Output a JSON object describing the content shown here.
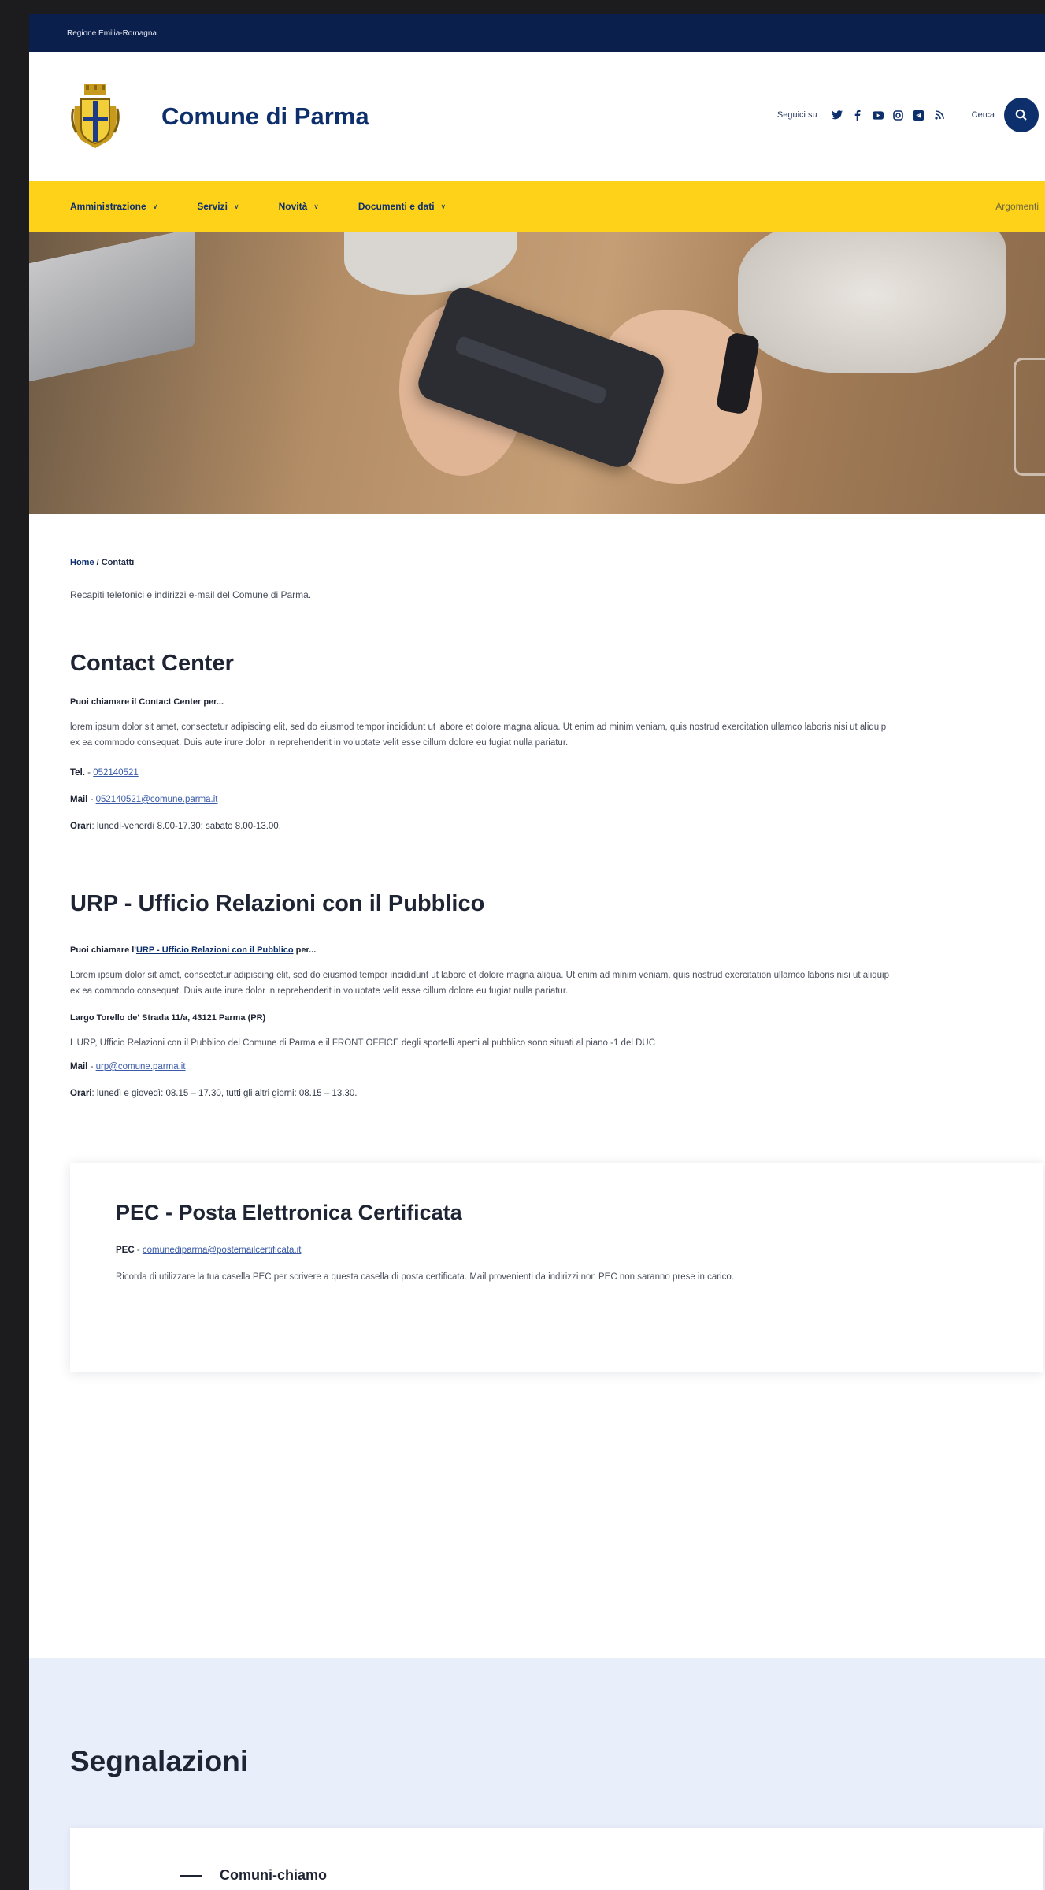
{
  "region_bar": {
    "label": "Regione Emilia-Romagna"
  },
  "header": {
    "title": "Comune di Parma",
    "follow_label": "Seguici su",
    "search_label": "Cerca",
    "social_icons": [
      "twitter-icon",
      "facebook-icon",
      "youtube-icon",
      "instagram-icon",
      "telegram-icon",
      "rss-icon"
    ]
  },
  "nav": {
    "items": [
      {
        "label": "Amministrazione"
      },
      {
        "label": "Servizi"
      },
      {
        "label": "Novità"
      },
      {
        "label": "Documenti e dati"
      }
    ],
    "topics": "Argomenti"
  },
  "breadcrumb": {
    "home": "Home",
    "separator": " / ",
    "current": "Contatti"
  },
  "intro": "Recapiti telefonici e indirizzi e-mail del Comune di Parma.",
  "contact_center": {
    "title": "Contact Center",
    "subhead": "Puoi chiamare il Contact Center per...",
    "lorem": "lorem ipsum dolor sit amet, consectetur adipiscing elit, sed do eiusmod tempor incididunt ut labore et dolore magna aliqua. Ut enim ad minim veniam, quis nostrud exercitation ullamco laboris nisi ut aliquip ex ea commodo consequat. Duis aute irure dolor in reprehenderit in voluptate velit esse cillum dolore eu fugiat nulla pariatur.",
    "tel_label": "Tel.",
    "tel_value": "052140521",
    "mail_label": "Mail",
    "mail_value": "052140521@comune.parma.it",
    "hours_label": "Orari",
    "hours_value": "lunedì-venerdì 8.00-17.30; sabato 8.00-13.00."
  },
  "urp": {
    "title": "URP - Ufficio Relazioni con il Pubblico",
    "subhead_pre": "Puoi chiamare l'",
    "subhead_link": "URP - Ufficio Relazioni con il Pubblico",
    "subhead_post": " per...",
    "lorem": "Lorem ipsum dolor sit amet, consectetur adipiscing elit, sed do eiusmod tempor incididunt ut labore et dolore magna aliqua. Ut enim ad minim veniam, quis nostrud exercitation ullamco laboris nisi ut aliquip ex ea commodo consequat. Duis aute irure dolor in reprehenderit in voluptate velit esse cillum dolore eu fugiat nulla pariatur.",
    "address": "Largo Torello de' Strada 11/a, 43121 Parma (PR)",
    "description": "L'URP, Ufficio Relazioni con il Pubblico del Comune di Parma e il FRONT OFFICE degli sportelli aperti al pubblico sono situati al piano -1 del DUC",
    "mail_label": "Mail",
    "mail_value": "urp@comune.parma.it",
    "hours_label": "Orari",
    "hours_value": "lunedì e giovedì: 08.15 – 17.30, tutti gli altri giorni: 08.15 – 13.30."
  },
  "pec": {
    "title": "PEC - Posta Elettronica Certificata",
    "label": "PEC",
    "value": "comunediparma@postemailcertificata.it",
    "note": "Ricorda di utilizzare la tua casella PEC per scrivere a questa casella di posta certificata. Mail provenienti da indirizzi non PEC non saranno prese in carico."
  },
  "segnalazioni": {
    "title": "Segnalazioni",
    "item": "Comuni-chiamo"
  },
  "colors": {
    "primary": "#0d2f6b",
    "nav_bg": "#ffd21a",
    "top_bar": "#0b1f4d",
    "section_bg": "#e8eefa"
  }
}
